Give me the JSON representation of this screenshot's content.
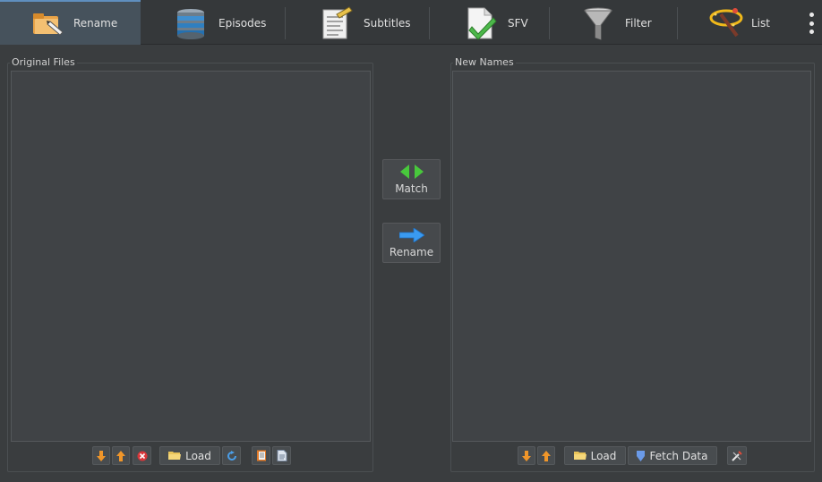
{
  "tabs": [
    {
      "label": "Rename",
      "icon": "rename-icon"
    },
    {
      "label": "Episodes",
      "icon": "episodes-icon"
    },
    {
      "label": "Subtitles",
      "icon": "subtitles-icon"
    },
    {
      "label": "SFV",
      "icon": "sfv-icon"
    },
    {
      "label": "Filter",
      "icon": "filter-icon"
    },
    {
      "label": "List",
      "icon": "list-icon"
    }
  ],
  "left_panel": {
    "title": "Original Files",
    "load_label": "Load"
  },
  "right_panel": {
    "title": "New Names",
    "load_label": "Load",
    "fetch_label": "Fetch Data"
  },
  "center": {
    "match_label": "Match",
    "rename_label": "Rename"
  },
  "colors": {
    "accent": "#5f8fbf",
    "background": "#3a3d3f",
    "list_bg": "#404346"
  }
}
